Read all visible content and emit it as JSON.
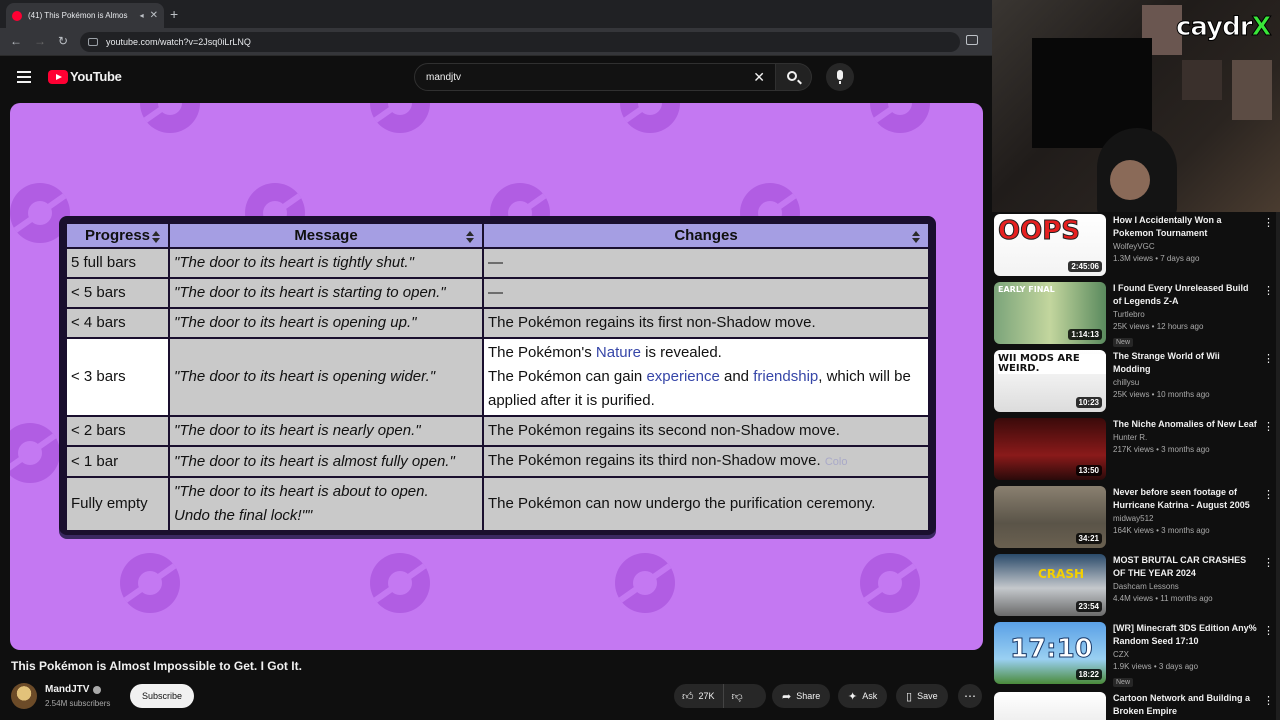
{
  "browser": {
    "tab_title": "(41) This Pokémon is Almos",
    "new_tab": "+",
    "url": "youtube.com/watch?v=2Jsq0iLrLNQ"
  },
  "masthead": {
    "logo": "YouTube",
    "search_value": "mandjtv"
  },
  "table": {
    "headers": [
      "Progress",
      "Message",
      "Changes"
    ],
    "rows": [
      {
        "progress": "5 full bars",
        "message": "\"The door to its heart is tightly shut.\"",
        "changes": "—"
      },
      {
        "progress": "< 5 bars",
        "message": "\"The door to its heart is starting to open.\"",
        "changes": "—"
      },
      {
        "progress": "< 4 bars",
        "message": "\"The door to its heart is opening up.\"",
        "changes": "The Pokémon regains its first non-Shadow move."
      },
      {
        "progress": "< 3 bars",
        "message": "\"The door to its heart is opening wider.\"",
        "changes_line1_a": "The Pokémon's ",
        "changes_line1_link": "Nature",
        "changes_line1_b": " is revealed.",
        "changes_line2_a": "The Pokémon can gain ",
        "changes_line2_link1": "experience",
        "changes_line2_mid": " and ",
        "changes_line2_link2": "friendship",
        "changes_line2_b": ", which will be applied after it is purified."
      },
      {
        "progress": "< 2 bars",
        "message": "\"The door to its heart is nearly open.\"",
        "changes": "The Pokémon regains its second non-Shadow move."
      },
      {
        "progress": "< 1 bar",
        "message": "\"The door to its heart is almost fully open.\"",
        "changes": "The Pokémon regains its third non-Shadow move.",
        "faint": "Colo"
      },
      {
        "progress": "Fully empty",
        "message_line1": "\"The door to its heart is about to open.",
        "message_line2": "Undo the final lock!\"\"",
        "changes": "The Pokémon can now undergo the purification ceremony."
      }
    ]
  },
  "video": {
    "title": "This Pokémon is Almost Impossible to Get. I Got It.",
    "channel": "MandJTV",
    "subscribers": "2.54M subscribers",
    "subscribe_label": "Subscribe",
    "likes": "27K",
    "share_label": "Share",
    "ask_label": "Ask",
    "save_label": "Save"
  },
  "webcam": {
    "logo_text": "caydr"
  },
  "sidebar": {
    "items": [
      {
        "title": "How I Accidentally Won a Pokemon Tournament",
        "channel": "WolfeyVGC",
        "meta": "1.3M views • 7 days ago",
        "duration": "2:45:06",
        "thumb_text": "OOPS",
        "new": ""
      },
      {
        "title": "I Found Every Unreleased Build of Legends Z-A",
        "channel": "Turtlebro",
        "meta": "25K views • 12 hours ago",
        "duration": "1:14:13",
        "thumb_text": "EARLY  FINAL",
        "new": "New"
      },
      {
        "title": "The Strange World of Wii Modding",
        "channel": "chillysu",
        "meta": "25K views • 10 months ago",
        "duration": "10:23",
        "thumb_text": "WII MODS ARE WEIRD.",
        "new": ""
      },
      {
        "title": "The Niche Anomalies of New Leaf",
        "channel": "Hunter R.",
        "meta": "217K views • 3 months ago",
        "duration": "13:50",
        "thumb_text": "",
        "new": ""
      },
      {
        "title": "Never before seen footage of Hurricane Katrina - August 2005",
        "channel": "midway512",
        "meta": "164K views • 3 months ago",
        "duration": "34:21",
        "thumb_text": "",
        "new": ""
      },
      {
        "title": "MOST BRUTAL CAR CRASHES OF THE YEAR 2024",
        "channel": "Dashcam Lessons",
        "meta": "4.4M views • 11 months ago",
        "duration": "23:54",
        "thumb_text": "CRASH",
        "new": ""
      },
      {
        "title": "[WR] Minecraft 3DS Edition Any% Random Seed 17:10",
        "channel": "CZX",
        "meta": "1.9K views • 3 days ago",
        "duration": "18:22",
        "thumb_text": "17:10",
        "new": "New"
      },
      {
        "title": "Cartoon Network and Building a Broken Empire",
        "channel": "",
        "meta": "",
        "duration": "",
        "thumb_text": "",
        "new": ""
      }
    ]
  },
  "colors": {
    "player_bg": "#c478f2",
    "table_header": "#a59ee3",
    "link": "#3646a8",
    "yt_red": "#ff0033"
  }
}
